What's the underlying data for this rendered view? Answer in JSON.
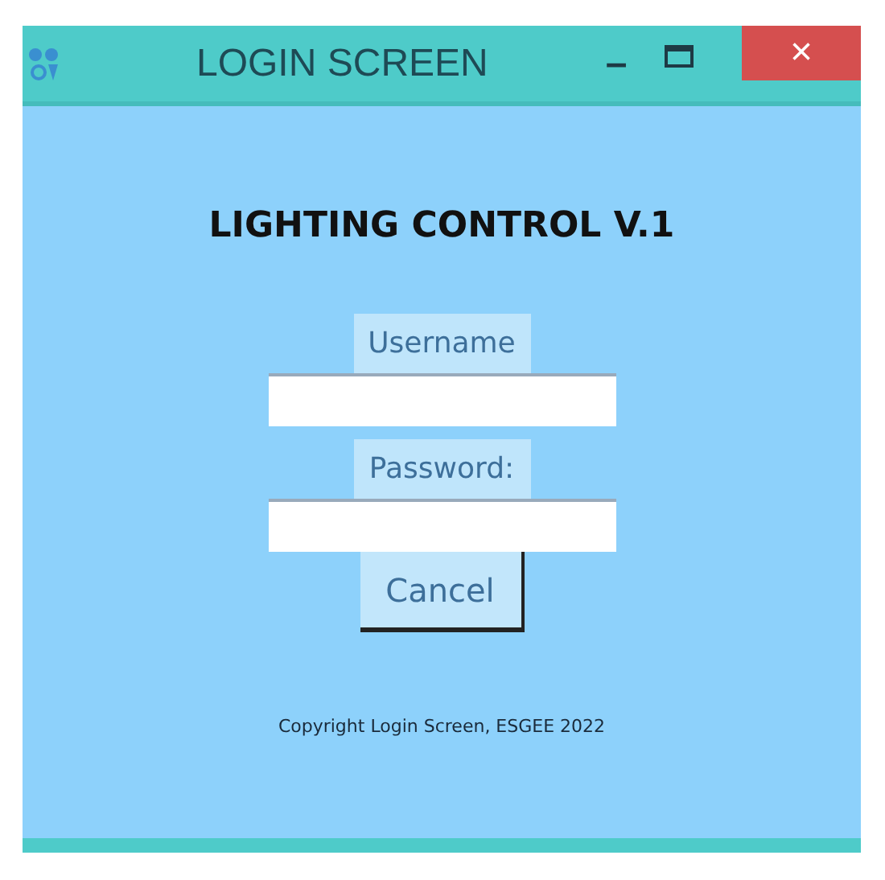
{
  "window": {
    "title": "LOGIN SCREEN",
    "buttons": [
      "–",
      "×"
    ]
  },
  "heading": "LIGHTING CONTROL V.1",
  "fields": [
    {
      "label": "Username"
    },
    {
      "label": "Password:"
    }
  ],
  "button": "Cancel",
  "footer": "Copyright Login Screen, ESGEE 2022"
}
